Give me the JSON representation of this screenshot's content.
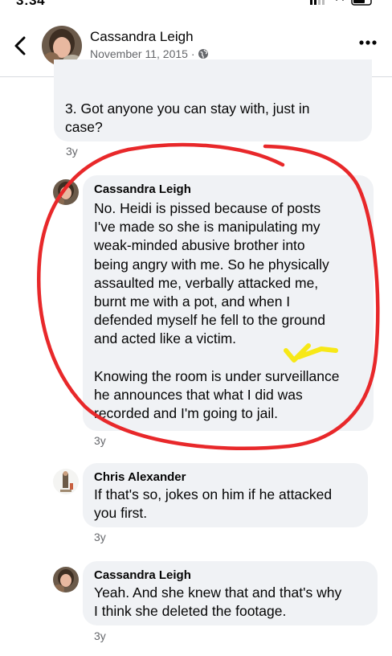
{
  "status_bar": {
    "time": "3:34"
  },
  "post": {
    "author": "Cassandra Leigh",
    "date": "November 11, 2015 ·"
  },
  "icons": {
    "back": "chevron-left-icon",
    "privacy": "globe-icon",
    "more": "more-horizontal-icon"
  },
  "comments": [
    {
      "text_lines": [
        "3. Got anyone you can stay with, just in",
        "case?"
      ],
      "time": "3y"
    },
    {
      "author": "Cassandra Leigh",
      "text_lines": [
        "No. Heidi is pissed because of posts",
        "I've made so she is manipulating my",
        "weak-minded abusive brother into",
        "being angry with me. So he physically",
        "assaulted me, verbally attacked me,",
        "burnt me with a pot, and when I",
        "defended myself he fell to the ground",
        "and acted like a victim.",
        "",
        "Knowing the room is under surveillance",
        "he announces that what I did was",
        "recorded and I'm going to jail."
      ],
      "time": "3y"
    },
    {
      "author": "Chris Alexander",
      "text_lines": [
        "If that's so, jokes on him if he attacked",
        "you first."
      ],
      "time": "3y"
    },
    {
      "author": "Cassandra Leigh",
      "text_lines": [
        "Yeah. And she knew that and that's why",
        "I think she deleted the footage."
      ],
      "time": "3y"
    }
  ],
  "annotation_colors": {
    "circle": "#e8282a",
    "check": "#f7e817"
  },
  "colors": {
    "bubble": "#f0f2f5",
    "meta": "#65676b",
    "text": "#050505"
  }
}
